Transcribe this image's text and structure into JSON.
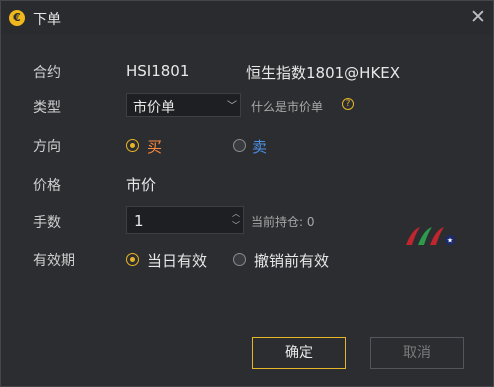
{
  "window": {
    "title": "下单",
    "close_glyph": "✕",
    "app_icon": "€"
  },
  "form": {
    "contract_label": "合约",
    "contract_code": "HSI1801",
    "contract_name": "恒生指数1801@HKEX",
    "type_label": "类型",
    "type_value": "市价单",
    "type_help_text": "什么是市价单",
    "direction_label": "方向",
    "direction_options": [
      {
        "label": "买",
        "selected": true,
        "color": "#ff8a3d"
      },
      {
        "label": "卖",
        "selected": false,
        "color": "#4a90e2"
      }
    ],
    "price_label": "价格",
    "price_value": "市价",
    "qty_label": "手数",
    "qty_value": "1",
    "position_hint": "当前持仓: 0",
    "validity_label": "有效期",
    "validity_options": [
      {
        "label": "当日有效",
        "selected": true
      },
      {
        "label": "撤销前有效",
        "selected": false
      }
    ]
  },
  "buttons": {
    "confirm": "确定",
    "cancel": "取消"
  },
  "colors": {
    "accent": "#e8b325",
    "buy": "#ff8a3d",
    "sell": "#4a90e2"
  }
}
